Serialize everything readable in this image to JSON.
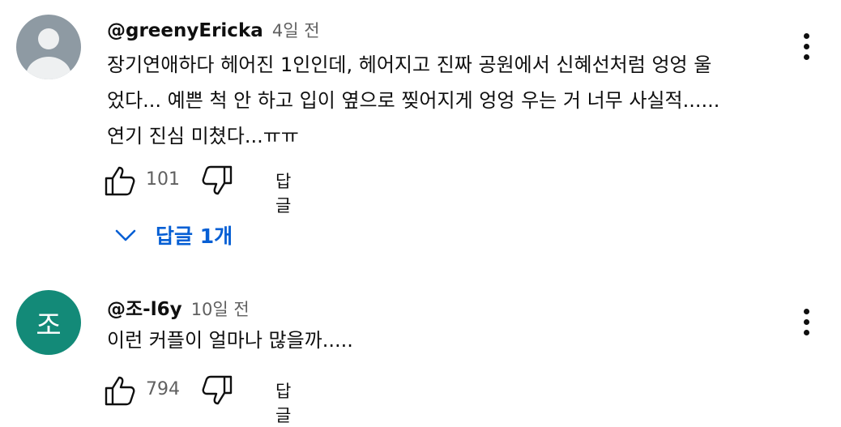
{
  "comments": [
    {
      "author": "@greenyEricka",
      "time": "4일 전",
      "avatar_letter": "",
      "text_lines": [
        "장기연애하다 헤어진 1인인데, 헤어지고 진짜 공원에서 신혜선처럼 엉엉 울",
        "었다... 예쁜 척 안 하고 입이 옆으로 찢어지게 엉엉 우는 거 너무 사실적......",
        "연기 진심 미쳤다...ㅠㅠ"
      ],
      "likes": "101",
      "reply_label": "답글",
      "replies_toggle": "답글 1개"
    },
    {
      "author": "@조-l6y",
      "time": "10일 전",
      "avatar_letter": "조",
      "text_lines": [
        "이런 커플이 얼마나 많을까....."
      ],
      "likes": "794",
      "reply_label": "답글"
    }
  ],
  "colors": {
    "link": "#065fd4",
    "avatar_teal": "#138a78",
    "avatar_default": "#8e9aa3",
    "secondary_text": "#606060"
  },
  "icons": [
    "default-avatar-icon",
    "like-icon",
    "dislike-icon",
    "more-menu-icon",
    "chevron-down-icon"
  ]
}
